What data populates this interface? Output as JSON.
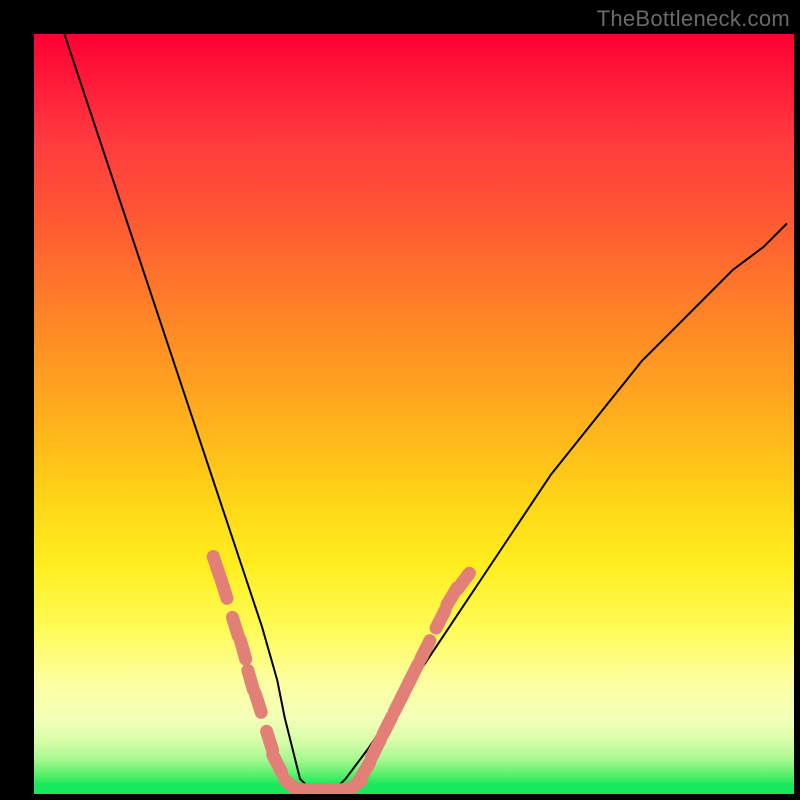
{
  "watermark": {
    "text": "TheBottleneck.com"
  },
  "chart_data": {
    "type": "line",
    "title": "",
    "xlabel": "",
    "ylabel": "",
    "xlim": [
      0,
      100
    ],
    "ylim": [
      0,
      100
    ],
    "grid": false,
    "legend": false,
    "background_gradient_stops": [
      {
        "pos": 0,
        "color": "#ff0033"
      },
      {
        "pos": 0.24,
        "color": "#ff5733"
      },
      {
        "pos": 0.54,
        "color": "#ffbb1a"
      },
      {
        "pos": 0.78,
        "color": "#fffb55"
      },
      {
        "pos": 0.96,
        "color": "#a6f890"
      },
      {
        "pos": 1.0,
        "color": "#17e85c"
      }
    ],
    "series": [
      {
        "name": "bottleneck-curve",
        "color": "#000000",
        "stroke_width": 2,
        "x": [
          4,
          6,
          8,
          10,
          12,
          14,
          16,
          18,
          20,
          22,
          24,
          26,
          28,
          30,
          32,
          33,
          34,
          35,
          37,
          39,
          41,
          44,
          48,
          52,
          56,
          60,
          64,
          68,
          72,
          76,
          80,
          84,
          88,
          92,
          96,
          99
        ],
        "values": [
          100,
          94,
          88,
          82,
          76,
          70,
          64,
          58,
          52,
          46,
          40,
          34,
          28,
          22,
          15,
          10,
          6,
          2,
          0,
          0,
          2,
          6,
          12,
          18,
          24,
          30,
          36,
          42,
          47,
          52,
          57,
          61,
          65,
          69,
          72,
          75
        ]
      }
    ],
    "markers": {
      "name": "highlighted-points",
      "color": "#e28077",
      "shape": "capsule",
      "points": [
        {
          "x": 24.0,
          "y": 30
        },
        {
          "x": 25.0,
          "y": 27
        },
        {
          "x": 26.5,
          "y": 22
        },
        {
          "x": 27.5,
          "y": 19
        },
        {
          "x": 28.5,
          "y": 15
        },
        {
          "x": 29.5,
          "y": 12
        },
        {
          "x": 31.0,
          "y": 7
        },
        {
          "x": 32.0,
          "y": 4
        },
        {
          "x": 34.0,
          "y": 1
        },
        {
          "x": 36.0,
          "y": 0.5
        },
        {
          "x": 38.0,
          "y": 0.5
        },
        {
          "x": 40.0,
          "y": 0.5
        },
        {
          "x": 42.0,
          "y": 1
        },
        {
          "x": 43.5,
          "y": 3
        },
        {
          "x": 45.0,
          "y": 6
        },
        {
          "x": 46.5,
          "y": 9
        },
        {
          "x": 48.0,
          "y": 12
        },
        {
          "x": 49.0,
          "y": 14
        },
        {
          "x": 50.0,
          "y": 16
        },
        {
          "x": 51.5,
          "y": 19
        },
        {
          "x": 53.5,
          "y": 23
        },
        {
          "x": 55.0,
          "y": 26
        },
        {
          "x": 56.5,
          "y": 28
        }
      ]
    }
  }
}
